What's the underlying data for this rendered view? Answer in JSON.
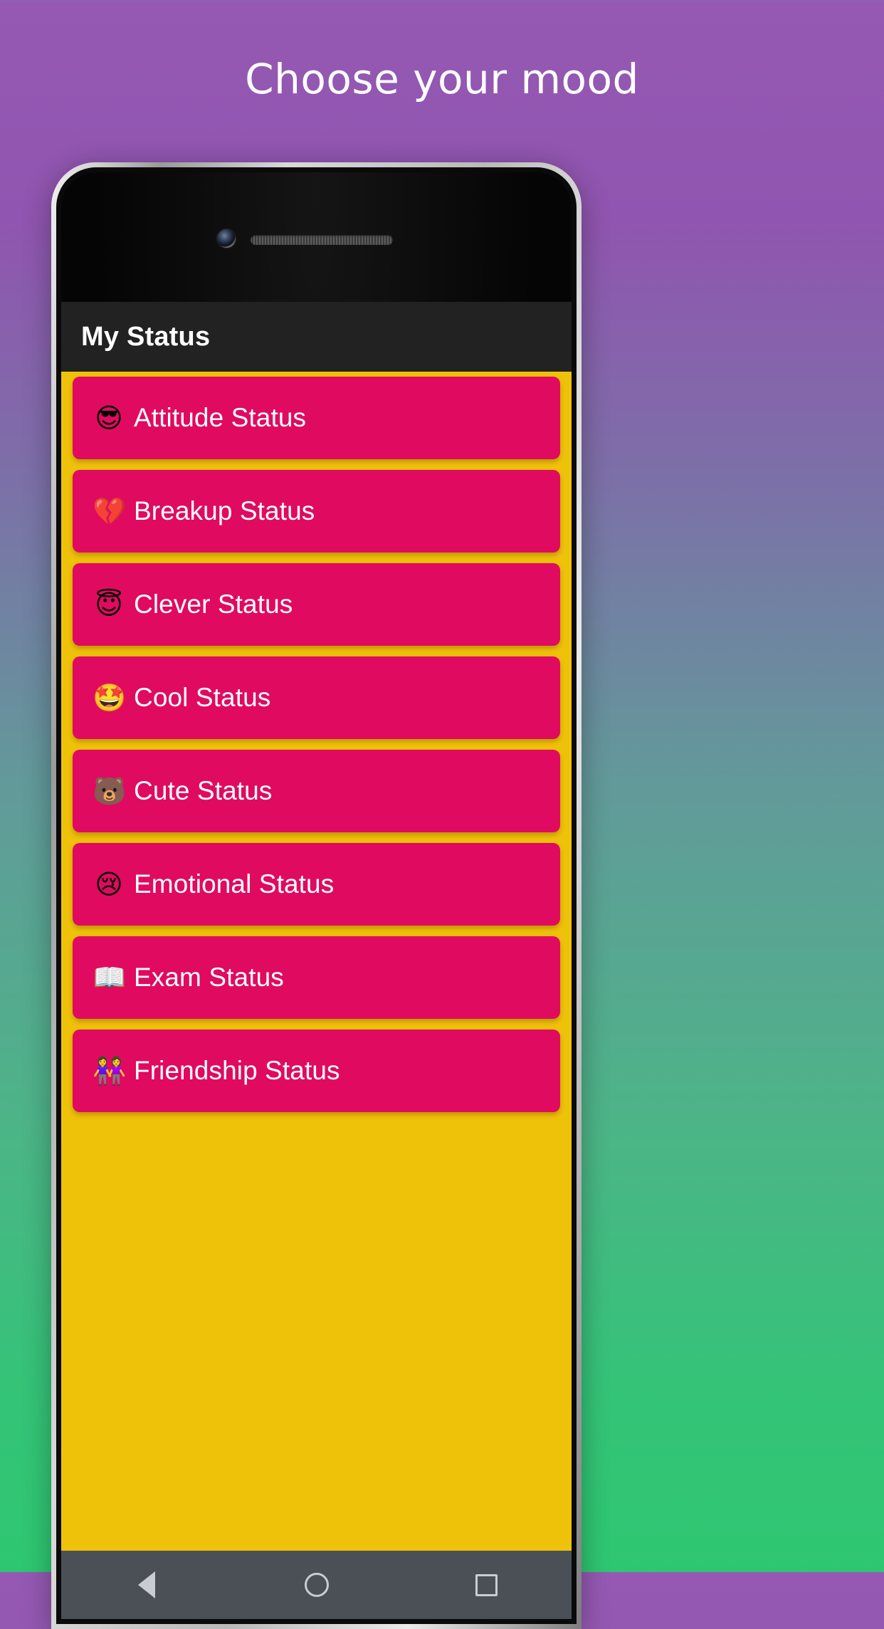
{
  "promo": {
    "headline": "Choose your mood"
  },
  "colors": {
    "background_top": "#9559b3",
    "background_mid": "#629a9a",
    "background_bottom": "#2ec771",
    "appbar": "#222222",
    "list_background": "#efc20a",
    "row": "#e00a60",
    "row_text": "#ffffff",
    "navbar": "#4a5056"
  },
  "app": {
    "appbar": {
      "title": "My Status"
    },
    "list": [
      {
        "emoji": "😎",
        "emoji_name": "smiling-face-with-sunglasses-icon",
        "label": "Attitude Status"
      },
      {
        "emoji": "💔",
        "emoji_name": "broken-heart-icon",
        "label": "Breakup Status"
      },
      {
        "emoji": "😇",
        "emoji_name": "smiling-face-with-halo-icon",
        "label": "Clever Status"
      },
      {
        "emoji": "🤩",
        "emoji_name": "star-struck-icon",
        "label": "Cool Status"
      },
      {
        "emoji": "🐻",
        "emoji_name": "bear-face-icon",
        "label": "Cute Status"
      },
      {
        "emoji": "😢",
        "emoji_name": "crying-face-icon",
        "label": "Emotional Status"
      },
      {
        "emoji": "📖",
        "emoji_name": "open-book-icon",
        "label": "Exam Status"
      },
      {
        "emoji": "👭",
        "emoji_name": "two-women-holding-hands-icon",
        "label": "Friendship Status"
      }
    ],
    "navbar": {
      "back": "back-icon",
      "home": "home-icon",
      "recents": "recents-icon"
    }
  }
}
